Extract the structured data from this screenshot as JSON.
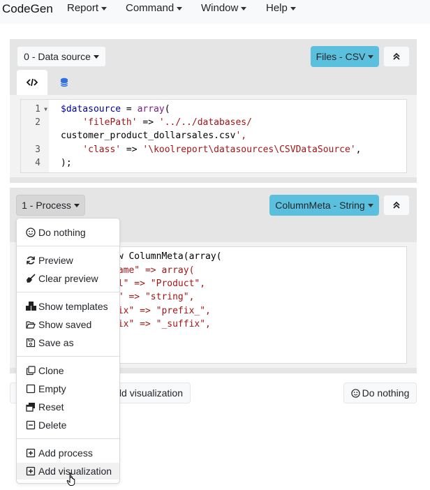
{
  "navbar": {
    "brand": "CodeGen",
    "menus": [
      {
        "label": "Report"
      },
      {
        "label": "Command"
      },
      {
        "label": "Window"
      },
      {
        "label": "Help"
      }
    ]
  },
  "datasource_panel": {
    "select_label": "0 - Data source",
    "type_label": "Files - CSV",
    "tabs": [
      "code-tab",
      "database-tab"
    ],
    "code_lines": [
      {
        "num": "1",
        "text": "$datasource = array("
      },
      {
        "num": "2",
        "text": "    'filePath' => '../../databases/",
        "wrap": "customer_product_dollarsales.csv',"
      },
      {
        "num": "3",
        "text": "    'class' => '\\koolreport\\datasources\\CSVDataSource',"
      },
      {
        "num": "4",
        "text": ");"
      }
    ]
  },
  "process_panel": {
    "select_label": "1 - Process",
    "type_label": "ColumnMeta - String",
    "code_lines": [
      "ew ColumnMeta(array(",
      "Name\" => array(",
      "el\" => \"Product\",",
      "e\" => \"string\",",
      "fix\" => \"prefix_\",",
      "fix\" => \"_suffix\","
    ]
  },
  "bottom_bar": {
    "add_visualization_partial": "dd visualization",
    "do_nothing_label": "Do nothing"
  },
  "dropdown": {
    "items": [
      {
        "label": "Do nothing",
        "icon": "smile-icon"
      },
      {
        "label": "Preview",
        "icon": "refresh-icon"
      },
      {
        "label": "Clear preview",
        "icon": "broom-icon"
      },
      {
        "label": "Show templates",
        "icon": "boxes-icon"
      },
      {
        "label": "Show saved",
        "icon": "folder-open-icon"
      },
      {
        "label": "Save as",
        "icon": "save-icon"
      },
      {
        "label": "Clone",
        "icon": "clone-icon"
      },
      {
        "label": "Empty",
        "icon": "square-icon"
      },
      {
        "label": "Reset",
        "icon": "window-restore-icon"
      },
      {
        "label": "Delete",
        "icon": "minus-square-icon"
      },
      {
        "label": "Add process",
        "icon": "plus-square-icon"
      },
      {
        "label": "Add visualization",
        "icon": "plus-square-icon"
      }
    ]
  },
  "colors": {
    "info": "#5bc0de",
    "panel": "#e5e5e5",
    "navbar": "#f8f9fa",
    "string": "#a31515",
    "function": "#7a1f86",
    "variable": "#0000a2"
  }
}
